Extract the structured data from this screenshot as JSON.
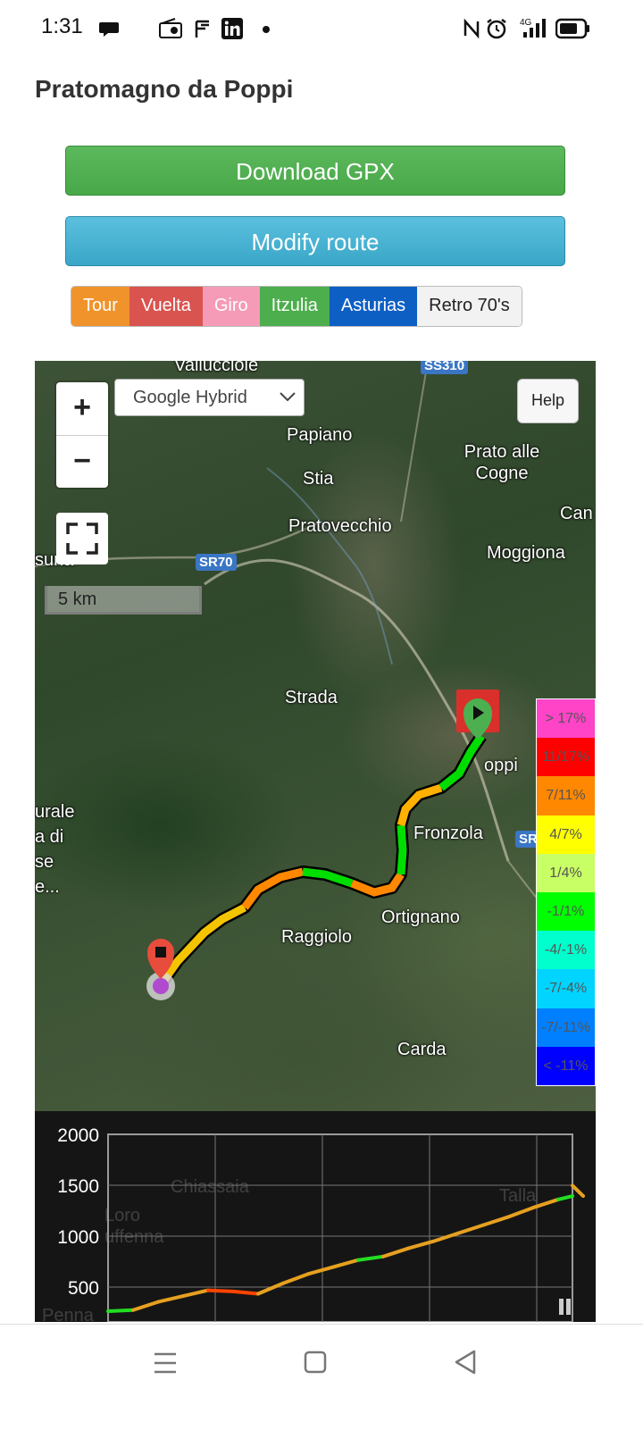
{
  "status": {
    "time": "1:31",
    "network": "4G"
  },
  "page": {
    "title": "Pratomagno da Poppi"
  },
  "buttons": {
    "download": "Download GPX",
    "modify": "Modify route"
  },
  "styles": [
    {
      "label": "Tour",
      "color": "#f0932b"
    },
    {
      "label": "Vuelta",
      "color": "#d9534f"
    },
    {
      "label": "Giro",
      "color": "#f59bb8"
    },
    {
      "label": "Itzulia",
      "color": "#4cae4c"
    },
    {
      "label": "Asturias",
      "color": "#0d5fc4"
    },
    {
      "label": "Retro 70's",
      "color": "#f2f2f2"
    }
  ],
  "map": {
    "zoom_in": "+",
    "zoom_out": "−",
    "layer": "Google Hybrid",
    "help": "Help",
    "scale": "5 km",
    "labels": [
      "Vallucciole",
      "Papiano",
      "Stia",
      "Prato alle Cogne",
      "Pratovecchio",
      "Moggiona",
      "Strada",
      "Fronzola",
      "Ortignano",
      "Raggiolo",
      "Carda",
      "urale",
      "a di",
      "se",
      "e...",
      "Can",
      "suna",
      "oppi"
    ],
    "roads": [
      "SR70",
      "SS310",
      "SR"
    ],
    "legend": [
      {
        "label": "> 17%",
        "color": "#ff44c8"
      },
      {
        "label": "11/17%",
        "color": "#ff0000"
      },
      {
        "label": "7/11%",
        "color": "#ff8800"
      },
      {
        "label": "4/7%",
        "color": "#ffff00"
      },
      {
        "label": "1/4%",
        "color": "#c8ff64"
      },
      {
        "label": "-1/1%",
        "color": "#00ff00"
      },
      {
        "label": "-4/-1%",
        "color": "#00ffcc"
      },
      {
        "label": "-7/-4%",
        "color": "#00d4ff"
      },
      {
        "label": "-7/-11%",
        "color": "#0080ff"
      },
      {
        "label": "< -11%",
        "color": "#0000ff"
      }
    ]
  },
  "chart_data": {
    "type": "line",
    "y_ticks": [
      "2000",
      "1500",
      "1000",
      "500"
    ],
    "ylim": [
      250,
      2000
    ],
    "grid": true,
    "background_labels": [
      "Chiassaia",
      "Loro",
      "uffenna",
      "Talla",
      "Penna"
    ],
    "x": [
      0,
      0.05,
      0.1,
      0.15,
      0.2,
      0.25,
      0.3,
      0.35,
      0.4,
      0.45,
      0.5,
      0.55,
      0.6,
      0.65,
      0.7,
      0.75,
      0.8,
      0.85,
      0.9,
      0.95,
      1.0
    ],
    "values": [
      480,
      490,
      560,
      610,
      660,
      650,
      630,
      720,
      800,
      860,
      920,
      950,
      1020,
      1080,
      1150,
      1220,
      1290,
      1370,
      1440,
      1470,
      1560
    ]
  }
}
